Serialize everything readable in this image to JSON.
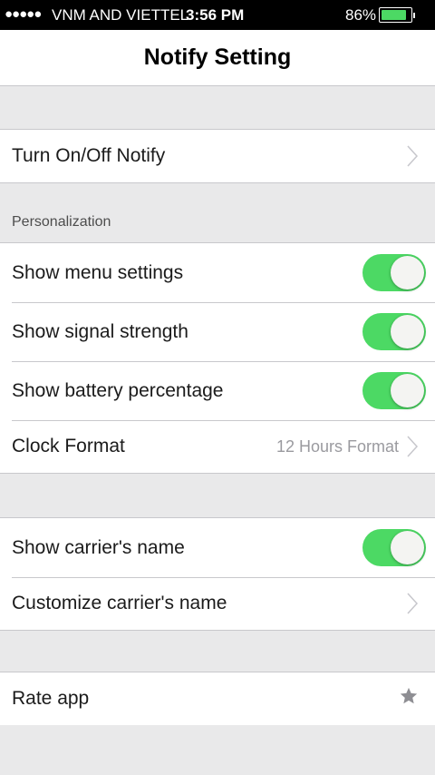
{
  "status_bar": {
    "signal": "●●●●●",
    "carrier": "VNM AND VIETTEL",
    "time": "3:56 PM",
    "battery_percent": "86%"
  },
  "nav": {
    "title": "Notify Setting"
  },
  "groups": {
    "notify": {
      "turn_on_off": "Turn On/Off Notify"
    },
    "personalization": {
      "header": "Personalization",
      "show_menu_settings": "Show menu settings",
      "show_signal_strength": "Show signal strength",
      "show_battery_percentage": "Show battery percentage",
      "clock_format": "Clock Format",
      "clock_format_value": "12 Hours Format"
    },
    "carrier": {
      "show_carrier_name": "Show carrier's name",
      "customize_carrier_name": "Customize carrier's name"
    },
    "rate": {
      "rate_app": "Rate app"
    }
  },
  "toggles": {
    "show_menu_settings": true,
    "show_signal_strength": true,
    "show_battery_percentage": true,
    "show_carrier_name": true
  },
  "icons": [
    "chevron-right-icon",
    "star-icon",
    "battery-icon"
  ],
  "colors": {
    "toggle_on": "#4cd964",
    "background": "#e9e9ea",
    "separator": "#c8c8cc"
  }
}
